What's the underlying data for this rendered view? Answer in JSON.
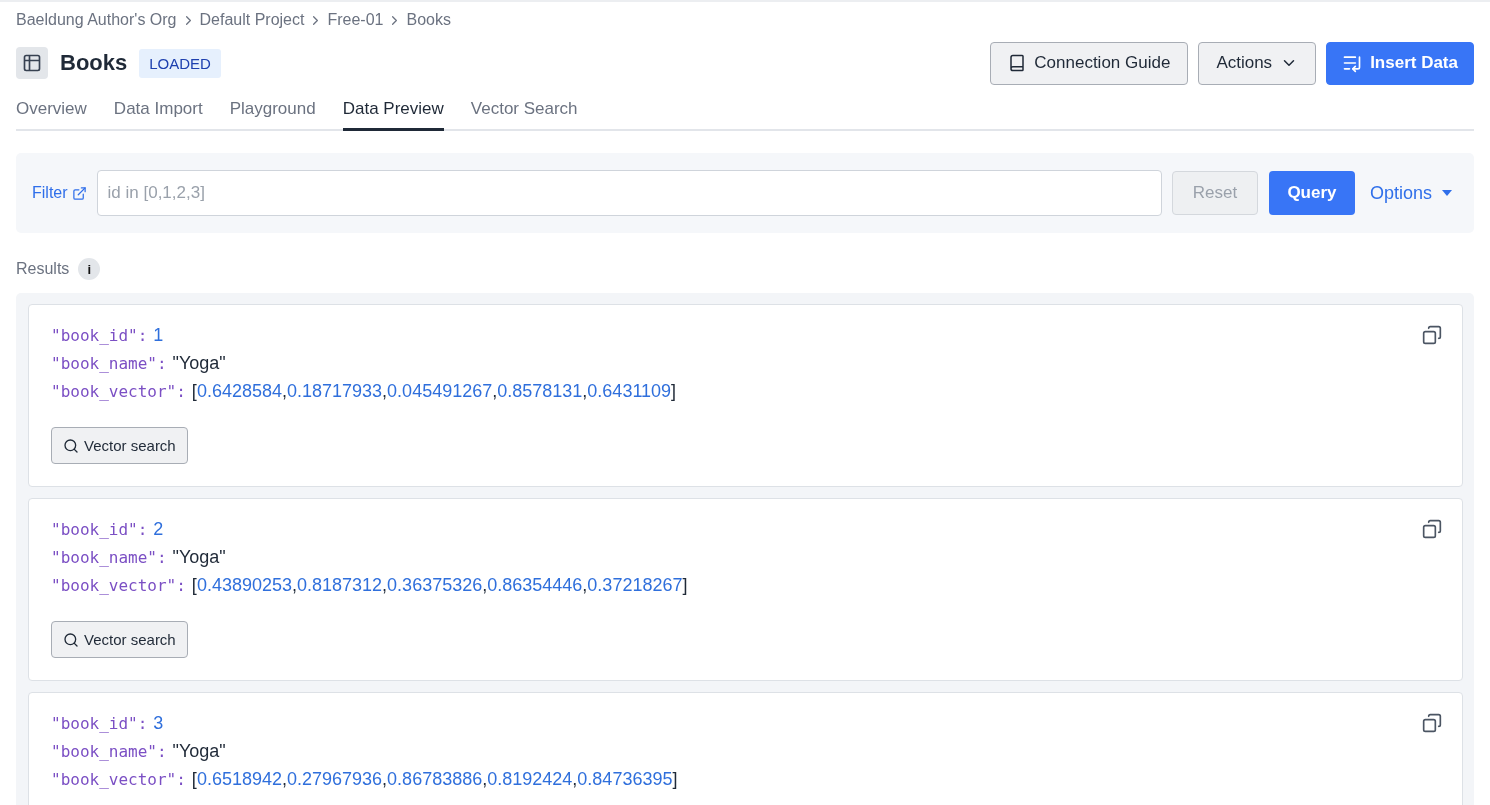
{
  "breadcrumb": [
    "Baeldung Author's Org",
    "Default Project",
    "Free-01",
    "Books"
  ],
  "header": {
    "title": "Books",
    "status": "LOADED",
    "buttons": [
      {
        "label": "Connection Guide",
        "kind": "guide"
      },
      {
        "label": "Actions",
        "kind": "menu"
      },
      {
        "label": "Insert Data",
        "kind": "primary"
      }
    ]
  },
  "tabs": [
    {
      "label": "Overview",
      "selected": false
    },
    {
      "label": "Data Import",
      "selected": false
    },
    {
      "label": "Playground",
      "selected": false
    },
    {
      "label": "Data Preview",
      "selected": true
    },
    {
      "label": "Vector Search",
      "selected": false
    }
  ],
  "filter": {
    "label": "Filter",
    "placeholder": "id in [0,1,2,3]",
    "reset": {
      "label": "Reset",
      "disabled": true
    },
    "query": "Query",
    "options": "Options"
  },
  "results": {
    "label": "Results",
    "info": "i",
    "records": [
      {
        "fields": [
          {
            "key": "\"book_id\":",
            "kind": "number",
            "value": "1"
          },
          {
            "key": "\"book_name\":",
            "kind": "string",
            "value": "\"Yoga\""
          },
          {
            "key": "\"book_vector\":",
            "kind": "vector",
            "open": "[",
            "close": "]",
            "separator": ",",
            "items": [
              "0.6428584",
              "0.18717933",
              "0.045491267",
              "0.8578131",
              "0.6431109"
            ]
          }
        ],
        "button": "Vector search"
      },
      {
        "fields": [
          {
            "key": "\"book_id\":",
            "kind": "number",
            "value": "2"
          },
          {
            "key": "\"book_name\":",
            "kind": "string",
            "value": "\"Yoga\""
          },
          {
            "key": "\"book_vector\":",
            "kind": "vector",
            "open": "[",
            "close": "]",
            "separator": ",",
            "items": [
              "0.43890253",
              "0.8187312",
              "0.36375326",
              "0.86354446",
              "0.37218267"
            ]
          }
        ],
        "button": "Vector search"
      },
      {
        "fields": [
          {
            "key": "\"book_id\":",
            "kind": "number",
            "value": "3"
          },
          {
            "key": "\"book_name\":",
            "kind": "string",
            "value": "\"Yoga\""
          },
          {
            "key": "\"book_vector\":",
            "kind": "vector",
            "open": "[",
            "close": "]",
            "separator": ",",
            "items": [
              "0.6518942",
              "0.27967936",
              "0.86783886",
              "0.8192424",
              "0.84736395"
            ]
          }
        ]
      }
    ]
  }
}
